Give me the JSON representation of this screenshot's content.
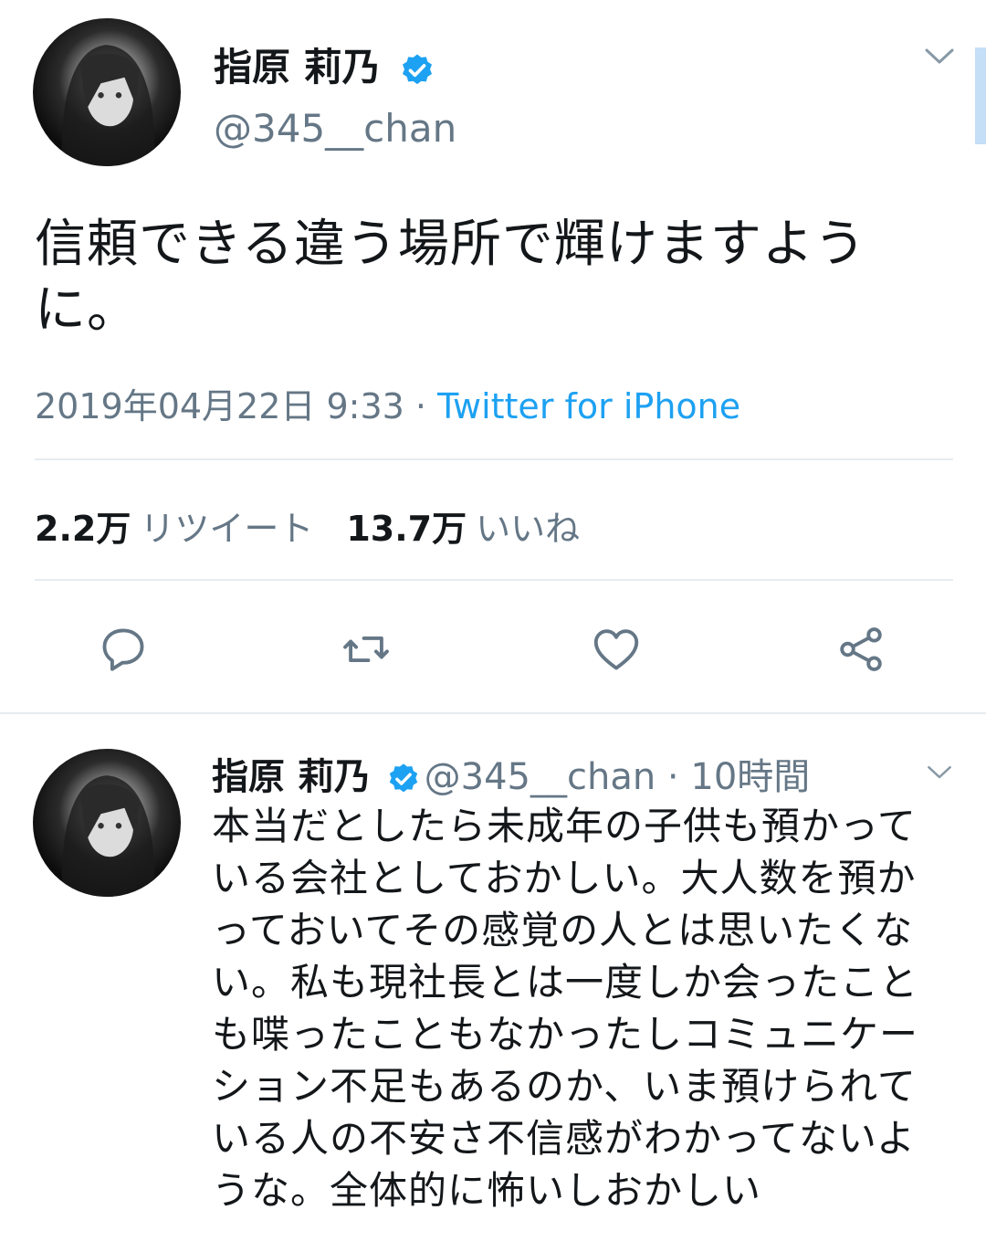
{
  "tweet": {
    "author_name": "指原 莉乃",
    "author_handle": "@345__chan",
    "text": "信頼できる違う場所で輝けますように。",
    "timestamp": "2019年04月22日 9:33",
    "separator": " · ",
    "source": "Twitter for iPhone",
    "retweet_count": "2.2万",
    "retweet_label": "リツイート",
    "like_count": "13.7万",
    "like_label": "いいね",
    "actions": [
      "reply-icon",
      "retweet-icon",
      "like-icon",
      "share-icon"
    ]
  },
  "reply": {
    "author_name": "指原 莉乃",
    "author_handle": "@345__chan",
    "separator": " · ",
    "time_ago": "10時間",
    "text": "本当だとしたら未成年の子供も預かっている会社としておかしい。大人数を預かっておいてその感覚の人とは思いたくない。私も現社長とは一度しか会ったことも喋ったこともなかったしコミュニケーション不足もあるのか、いま預けられている人の不安さ不信感がわかってないような。全体的に怖いしおかしい"
  },
  "colors": {
    "text": "#14171a",
    "secondary": "#657786",
    "link": "#1da1f2",
    "verified": "#1da1f2",
    "divider": "#e6ecf0"
  }
}
